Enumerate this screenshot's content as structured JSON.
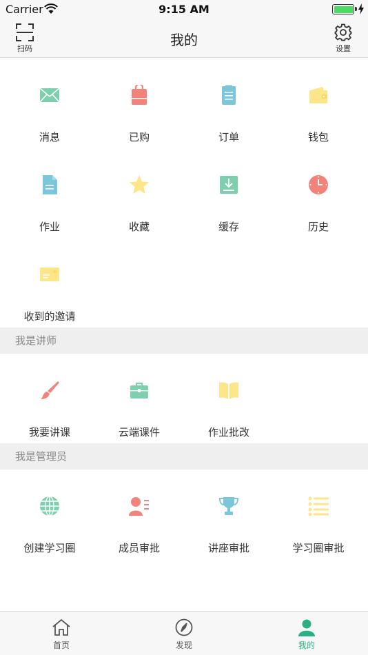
{
  "status_bar": {
    "carrier": "Carrier",
    "time": "9:15 AM"
  },
  "nav": {
    "title": "我的",
    "scan_label": "扫码",
    "settings_label": "设置"
  },
  "colors": {
    "green": "#7ecfae",
    "red": "#f2837b",
    "blue": "#7cc6dc",
    "yellow": "#fde58a",
    "accent": "#2bb084"
  },
  "main_grid": [
    {
      "label": "消息",
      "icon": "mail-icon"
    },
    {
      "label": "已购",
      "icon": "shopping-bag-icon"
    },
    {
      "label": "订单",
      "icon": "order-list-icon"
    },
    {
      "label": "钱包",
      "icon": "wallet-icon"
    },
    {
      "label": "作业",
      "icon": "document-icon"
    },
    {
      "label": "收藏",
      "icon": "star-icon"
    },
    {
      "label": "缓存",
      "icon": "download-icon"
    },
    {
      "label": "历史",
      "icon": "clock-icon"
    },
    {
      "label": "收到的邀请",
      "icon": "invitation-card-icon"
    }
  ],
  "teacher_section": {
    "title": "我是讲师",
    "items": [
      {
        "label": "我要讲课",
        "icon": "brush-icon"
      },
      {
        "label": "云端课件",
        "icon": "briefcase-icon"
      },
      {
        "label": "作业批改",
        "icon": "open-book-icon"
      }
    ]
  },
  "admin_section": {
    "title": "我是管理员",
    "items": [
      {
        "label": "创建学习圈",
        "icon": "globe-icon"
      },
      {
        "label": "成员审批",
        "icon": "member-icon"
      },
      {
        "label": "讲座审批",
        "icon": "trophy-icon"
      },
      {
        "label": "学习圈审批",
        "icon": "list-icon"
      }
    ]
  },
  "tab_bar": {
    "tabs": [
      {
        "label": "首页",
        "icon": "home-icon",
        "active": false
      },
      {
        "label": "发现",
        "icon": "compass-icon",
        "active": false
      },
      {
        "label": "我的",
        "icon": "profile-icon",
        "active": true
      }
    ]
  }
}
